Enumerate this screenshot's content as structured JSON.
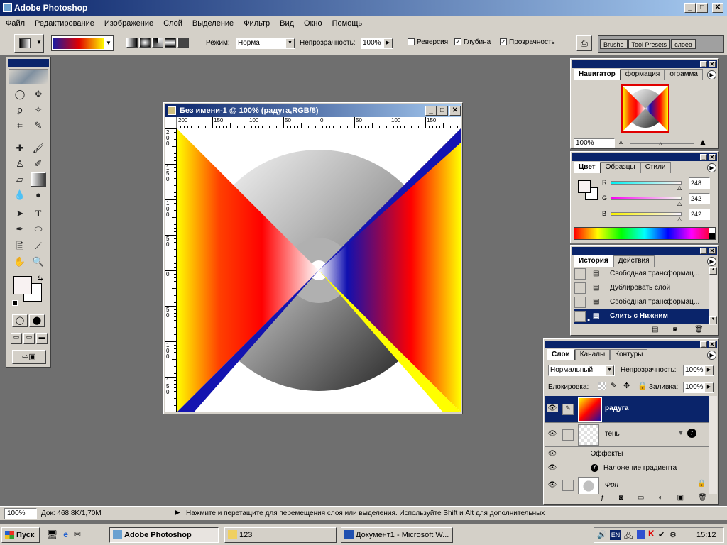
{
  "app": {
    "title": "Adobe Photoshop",
    "colors": {
      "titlebar": "#0a246a",
      "workspace": "#6f6f6f",
      "chrome": "#d4d0c8",
      "selection": "#0a246a"
    }
  },
  "menu": [
    "Файл",
    "Редактирование",
    "Изображение",
    "Слой",
    "Выделение",
    "Фильтр",
    "Вид",
    "Окно",
    "Помощь"
  ],
  "options": {
    "mode_label": "Режим:",
    "mode_value": "Норма",
    "opacity_label": "Непрозрачность:",
    "opacity_value": "100%",
    "reverse_label": "Реверсия",
    "reverse_checked": false,
    "dither_label": "Глубина",
    "dither_checked": true,
    "transparency_label": "Прозрачность",
    "transparency_checked": true,
    "well_tabs": [
      "Brushe",
      "Tool Presets",
      "слоев"
    ]
  },
  "document": {
    "title": "Без имени-1 @ 100% (радуга,RGB/8)",
    "ruler_top": [
      "200",
      "150",
      "100",
      "50",
      "0",
      "50",
      "100",
      "150"
    ],
    "ruler_left": [
      "200",
      "150",
      "100",
      "50",
      "0",
      "50",
      "100",
      "150"
    ]
  },
  "navigator": {
    "tabs": [
      "Навигатор",
      "формация",
      "ограмма"
    ],
    "zoom": "100%"
  },
  "color_panel": {
    "tabs": [
      "Цвет",
      "Образцы",
      "Стили"
    ],
    "r_label": "R",
    "r_value": "248",
    "g_label": "G",
    "g_value": "242",
    "b_label": "B",
    "b_value": "242"
  },
  "history": {
    "tabs": [
      "История",
      "Действия"
    ],
    "items": [
      {
        "label": "Свободная трансформац...",
        "active": false
      },
      {
        "label": "Дублировать слой",
        "active": false
      },
      {
        "label": "Свободная трансформац...",
        "active": false
      },
      {
        "label": "Слить с Нижним",
        "active": true
      }
    ]
  },
  "layers": {
    "tabs": [
      "Слои",
      "Каналы",
      "Контуры"
    ],
    "blend_mode": "Нормальный",
    "opacity_label": "Непрозрачность:",
    "opacity_value": "100%",
    "lock_label": "Блокировка:",
    "fill_label": "Заливка:",
    "fill_value": "100%",
    "items": [
      {
        "name": "радуга",
        "selected": true
      },
      {
        "name": "тень",
        "selected": false
      },
      {
        "name": "Эффекты",
        "selected": false
      },
      {
        "name": "Наложение градиента",
        "selected": false
      },
      {
        "name": "Фон",
        "selected": false
      }
    ]
  },
  "status": {
    "zoom": "100%",
    "doc": "Док: 468,8K/1,70M",
    "hint": "Нажмите и перетащите для перемещения слоя или выделения. Используйте Shift и Alt для дополнительных"
  },
  "taskbar": {
    "start": "Пуск",
    "tasks": [
      "Adobe Photoshop",
      "123",
      "Документ1 - Microsoft W..."
    ],
    "lang": "EN",
    "clock": "15:12"
  }
}
